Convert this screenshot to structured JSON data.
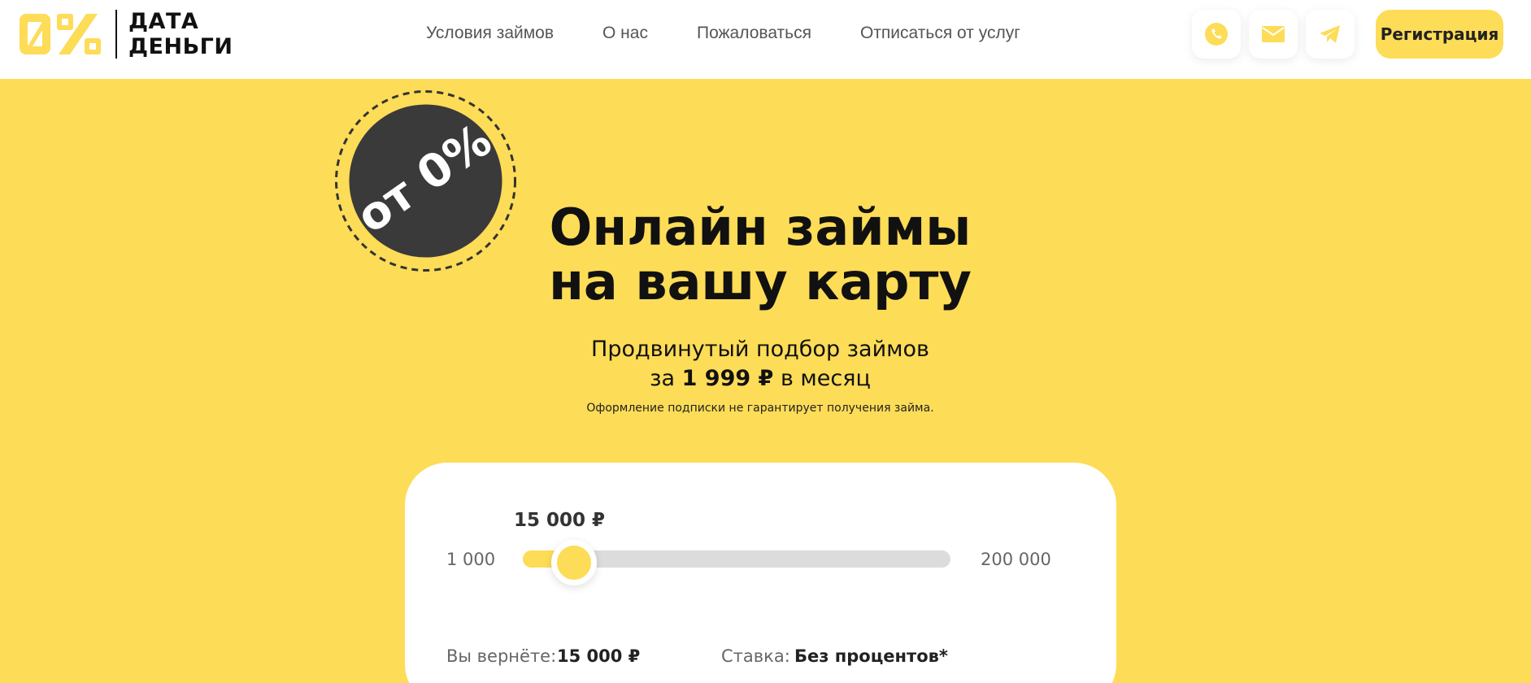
{
  "header": {
    "logo": {
      "mark": "0%",
      "line1": "ДАТА",
      "line2": "ДЕНЬГИ"
    },
    "nav": [
      {
        "label": "Условия займов"
      },
      {
        "label": "О нас"
      },
      {
        "label": "Пожаловаться"
      },
      {
        "label": "Отписаться от услуг"
      }
    ],
    "contacts": [
      {
        "icon": "phone-icon"
      },
      {
        "icon": "mail-icon"
      },
      {
        "icon": "telegram-icon"
      }
    ],
    "register_label": "Регистрация"
  },
  "badge": {
    "text": "от 0%"
  },
  "hero": {
    "title_line1": "Онлайн займы",
    "title_line2": "на вашу карту",
    "subtitle_line1": "Продвинутый подбор займов",
    "subtitle_prefix": "за",
    "subtitle_price": "1 999 ₽",
    "subtitle_suffix": "в месяц",
    "note": "Оформление подписки не гарантирует получения займа."
  },
  "calculator": {
    "amount_label": "15 000 ₽",
    "min_label": "1 000",
    "max_label": "200 000",
    "min_value": 1000,
    "max_value": 200000,
    "current_value": 15000,
    "return_label": "Вы вернёте:",
    "return_value": "15 000 ₽",
    "rate_label": "Ставка:",
    "rate_value": "Без процентов*"
  },
  "colors": {
    "brand_yellow": "#fddc57",
    "badge_dark": "#3a3a3a",
    "track_grey": "#dcdcdc"
  }
}
